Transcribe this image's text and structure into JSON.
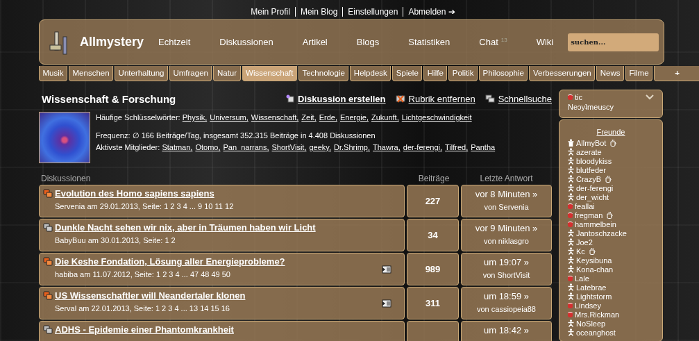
{
  "top_links": [
    "Mein Profil",
    "Mein Blog",
    "Einstellungen",
    "Abmelden ➔"
  ],
  "header": {
    "site_name": "Allmystery",
    "nav": [
      {
        "label": "Echtzeit"
      },
      {
        "label": "Diskussionen"
      },
      {
        "label": "Artikel"
      },
      {
        "label": "Blogs"
      },
      {
        "label": "Statistiken"
      },
      {
        "label": "Chat",
        "badge": "13"
      },
      {
        "label": "Wiki"
      }
    ],
    "search": {
      "placeholder": "suchen..."
    }
  },
  "categories": [
    {
      "label": "Musik",
      "selected": false
    },
    {
      "label": "Menschen",
      "selected": false
    },
    {
      "label": "Unterhaltung",
      "selected": false
    },
    {
      "label": "Umfragen",
      "selected": false
    },
    {
      "label": "Natur",
      "selected": false
    },
    {
      "label": "Wissenschaft",
      "selected": true
    },
    {
      "label": "Technologie",
      "selected": false
    },
    {
      "label": "Helpdesk",
      "selected": false
    },
    {
      "label": "Spiele",
      "selected": false
    },
    {
      "label": "Hilfe",
      "selected": false
    },
    {
      "label": "Politik",
      "selected": false
    },
    {
      "label": "Philosophie",
      "selected": false
    },
    {
      "label": "Verbesserungen",
      "selected": false
    },
    {
      "label": "News",
      "selected": false
    },
    {
      "label": "Filme",
      "selected": false
    },
    {
      "label": "+",
      "selected": false
    }
  ],
  "section": {
    "title": "Wissenschaft & Forschung",
    "actions": [
      "Diskussion erstellen",
      "Rubrik entfernen",
      "Schnellsuche"
    ],
    "keywords_label": "Häufige Schlüsselwörter:",
    "keywords": [
      "Physik,",
      "Universum,",
      "Wissenschaft,",
      "Zeit,",
      "Erde,",
      "Energie,",
      "Zukunft,",
      "Lichtgeschwindigkeit"
    ],
    "frequency": "Frequenz: ∅ 166 Beiträge/Tag, insgesamt 352.315 Beiträge in 4.408 Diskussionen",
    "members_label": "Aktivste Mitglieder:",
    "members": [
      "Statman,",
      "Otomo,",
      "Pan_narrans,",
      "ShortVisit,",
      "geeky,",
      "Dr.Shrimp,",
      "Thawra,",
      "der-ferengi,",
      "Tilfred,",
      "Pantha"
    ]
  },
  "table": {
    "columns": [
      "Diskussionen",
      "Beiträge",
      "Letzte Antwort"
    ],
    "rows": [
      {
        "title": "Evolution des Homo sapiens sapiens",
        "meta": "Servenia am 29.01.2013, Seite: 1 2 3 4 ... 9 10 11 12",
        "hot": true,
        "extra_icon": false,
        "posts": "227",
        "last": "vor 8 Minuten »",
        "by": "von Servenia"
      },
      {
        "title": "Dunkle Nacht sehen wir nix, aber in Träumen haben wir Licht",
        "meta": "BabyBuu am 30.01.2013, Seite: 1 2",
        "hot": false,
        "extra_icon": false,
        "posts": "34",
        "last": "vor 9 Minuten »",
        "by": "von niklasgro"
      },
      {
        "title": "Die Keshe Fondation, Lösung aller Energieprobleme?",
        "meta": "habiba am 11.07.2012, Seite: 1 2 3 4 ... 47 48 49 50",
        "hot": true,
        "extra_icon": true,
        "posts": "989",
        "last": "um 19:07 »",
        "by": "von ShortVisit"
      },
      {
        "title": "US Wissenschaftler will Neandertaler klonen",
        "meta": "Serval am 22.01.2013, Seite: 1 2 3 4 ... 13 14 15 16",
        "hot": true,
        "extra_icon": true,
        "posts": "311",
        "last": "um 18:59 »",
        "by": "von cassiopeia88"
      },
      {
        "title": "ADHS - Epidemie einer Phantomkrankheit",
        "hot": false,
        "extra_icon": false,
        "last": "um 18:42 »"
      }
    ]
  },
  "sidebar": {
    "user": {
      "name": "tic",
      "kind": "busy",
      "motto": "Neɔyʇmeuscy"
    },
    "friends_title": "Freunde",
    "friends": [
      {
        "name": "AllmyBot",
        "kind": "bot",
        "mug": true
      },
      {
        "name": "azerate",
        "kind": "online",
        "mug": false
      },
      {
        "name": "bloodykiss",
        "kind": "online",
        "mug": false
      },
      {
        "name": "blutfeder",
        "kind": "online",
        "mug": false
      },
      {
        "name": "CrazyB",
        "kind": "online",
        "mug": true
      },
      {
        "name": "der-ferengi",
        "kind": "online",
        "mug": false
      },
      {
        "name": "der_wicht",
        "kind": "online",
        "mug": false
      },
      {
        "name": "feallai",
        "kind": "busy",
        "mug": false
      },
      {
        "name": "fregman",
        "kind": "busy",
        "mug": true
      },
      {
        "name": "hammelbein",
        "kind": "busy",
        "mug": false
      },
      {
        "name": "Jantoschzacke",
        "kind": "online",
        "mug": false
      },
      {
        "name": "Joe2",
        "kind": "online",
        "mug": false
      },
      {
        "name": "Kc",
        "kind": "online",
        "mug": true
      },
      {
        "name": "Keysibuna",
        "kind": "online",
        "mug": false
      },
      {
        "name": "Kona-chan",
        "kind": "online",
        "mug": false
      },
      {
        "name": "Lale",
        "kind": "busy",
        "mug": false
      },
      {
        "name": "Latebrae",
        "kind": "online",
        "mug": false
      },
      {
        "name": "Lightstorm",
        "kind": "online",
        "mug": false
      },
      {
        "name": "Lindsey",
        "kind": "busy",
        "mug": false
      },
      {
        "name": "Mrs.Rickman",
        "kind": "busy",
        "mug": false
      },
      {
        "name": "NoSleep",
        "kind": "online",
        "mug": false
      },
      {
        "name": "oceanghost",
        "kind": "online",
        "mug": false
      }
    ]
  }
}
